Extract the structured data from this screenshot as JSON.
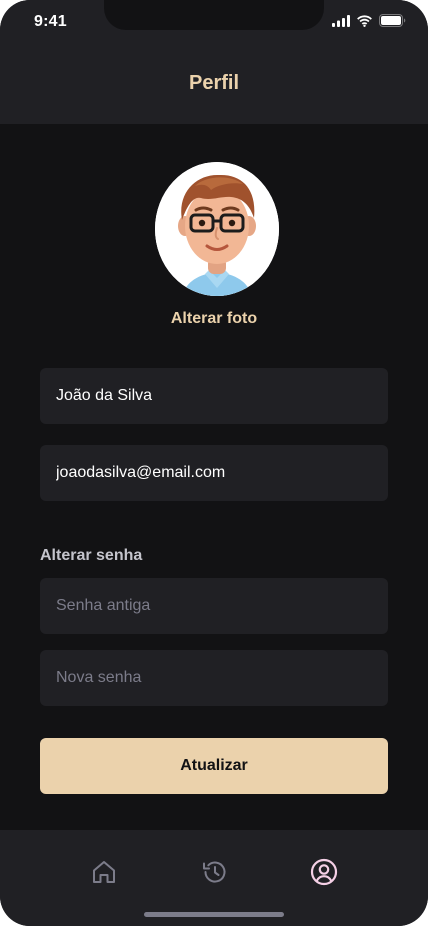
{
  "status_bar": {
    "time": "9:41"
  },
  "header": {
    "title": "Perfil"
  },
  "profile": {
    "change_photo_label": "Alterar foto",
    "name_value": "João da Silva",
    "email_value": "joaodasilva@email.com"
  },
  "password": {
    "section_label": "Alterar senha",
    "old_placeholder": "Senha antiga",
    "new_placeholder": "Nova senha"
  },
  "actions": {
    "submit_label": "Atualizar"
  },
  "tabbar": {
    "items": [
      {
        "icon": "home-icon",
        "active": false
      },
      {
        "icon": "history-icon",
        "active": false
      },
      {
        "icon": "user-circle-icon",
        "active": true
      }
    ]
  },
  "colors": {
    "background": "#121214",
    "surface": "#202024",
    "accent": "#EBD2AC",
    "active_tab": "#F5D0E6",
    "inactive_tab": "#7C7C8A"
  }
}
